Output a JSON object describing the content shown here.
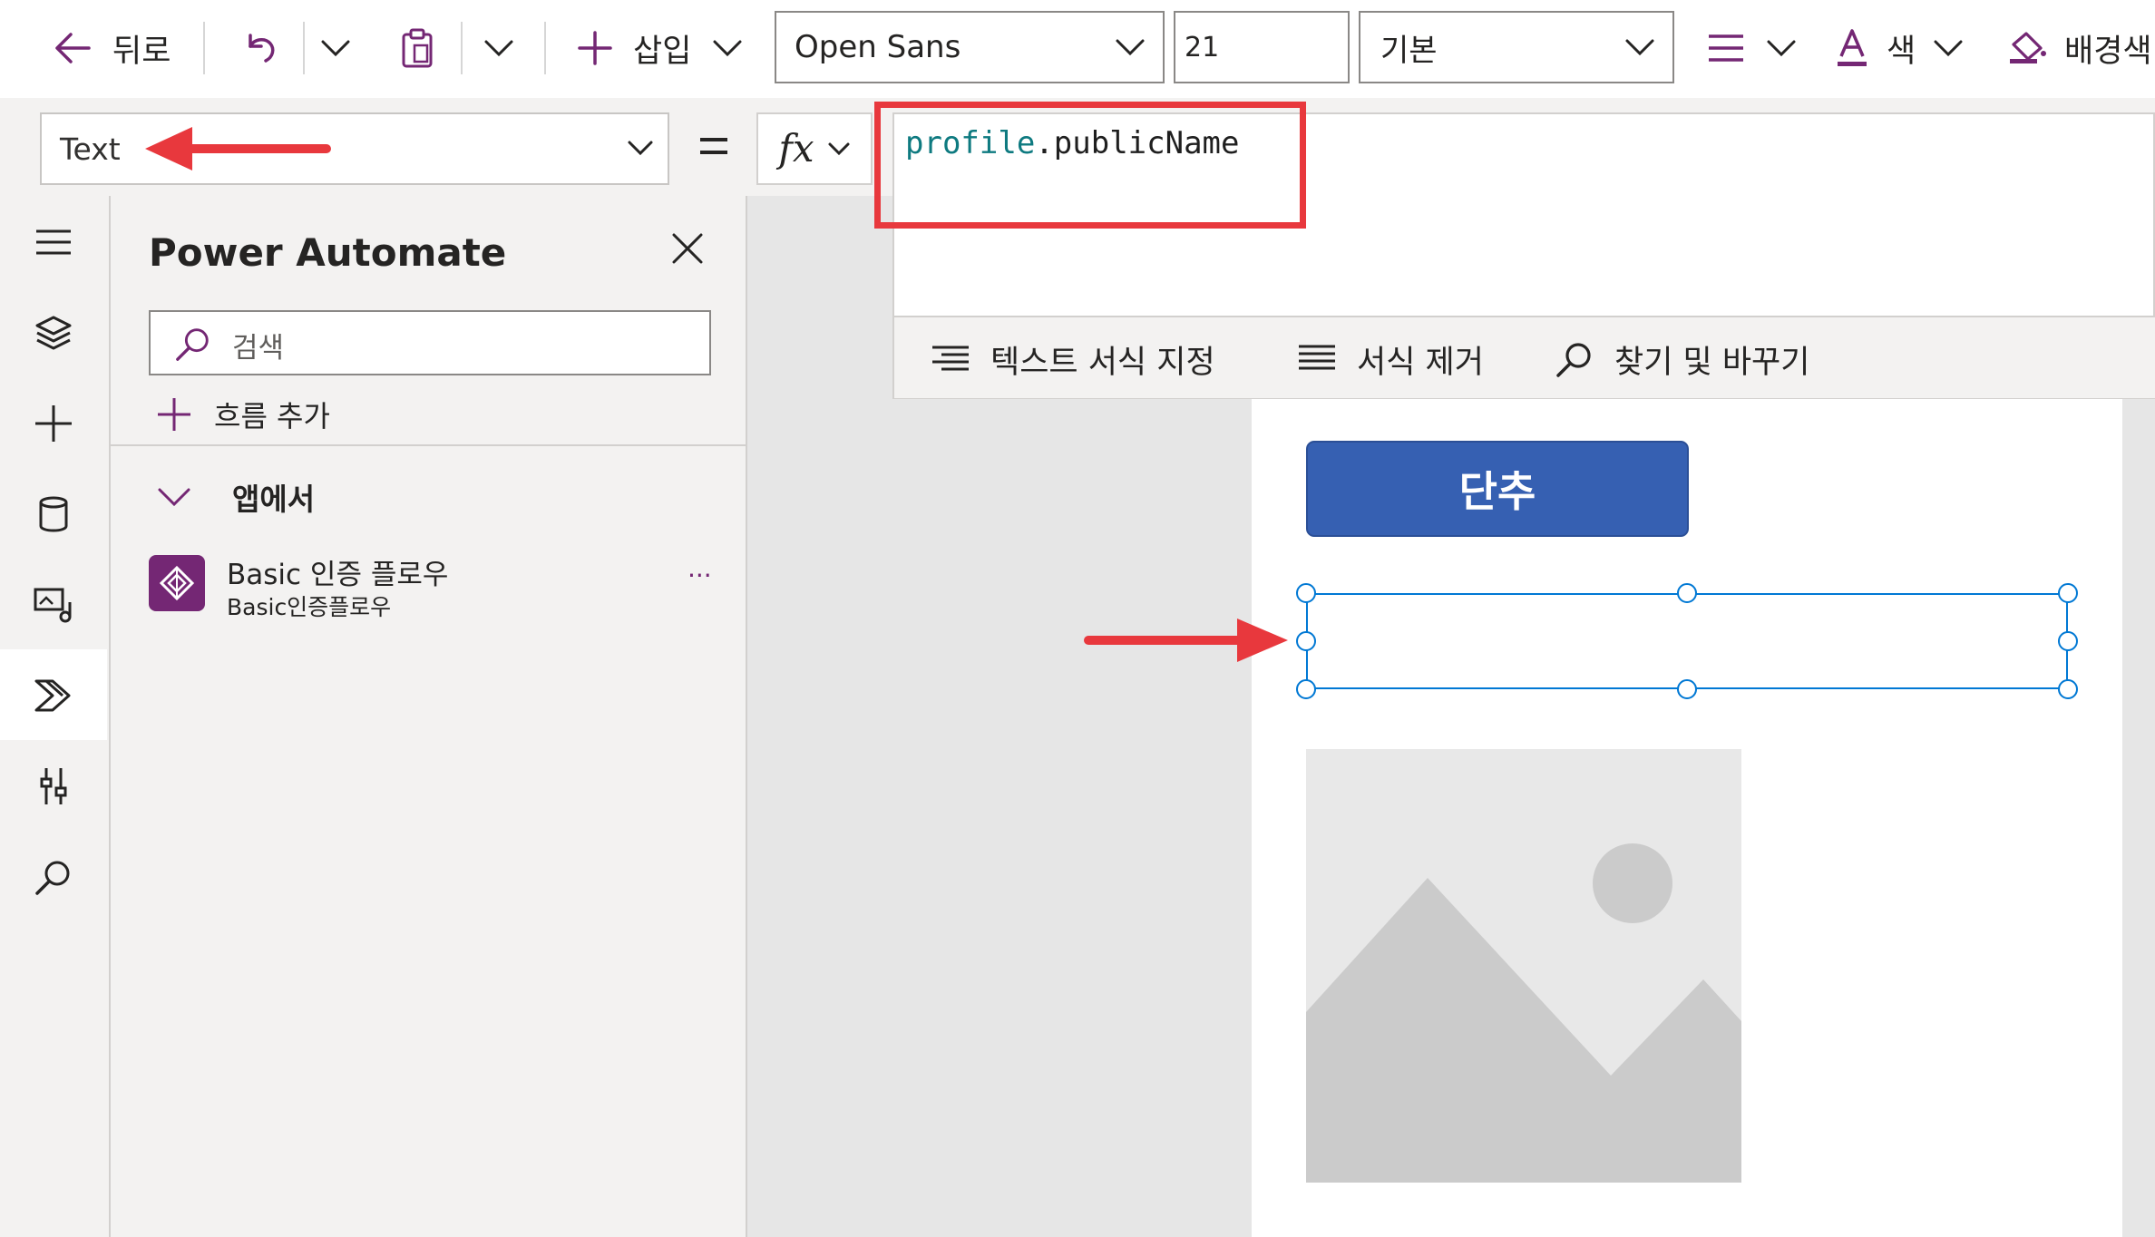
{
  "toolbar": {
    "back_label": "뒤로",
    "insert_label": "삽입",
    "font_name": "Open Sans",
    "font_size": "21",
    "font_weight": "기본",
    "color_label": "색",
    "fill_label": "배경색"
  },
  "formula_bar": {
    "property": "Text",
    "formula_object": "profile",
    "formula_dot": ".",
    "formula_member": "publicName"
  },
  "formula_tools": {
    "format_text": "텍스트 서식 지정",
    "remove_format": "서식 제거",
    "find_replace": "찾기 및 바꾸기"
  },
  "panel": {
    "title": "Power Automate",
    "search_placeholder": "검색",
    "add_flow": "흐름 추가",
    "section_label": "앱에서",
    "flows": [
      {
        "name": "Basic 인증 플로우",
        "subtitle": "Basic인증플로우",
        "more": "..."
      }
    ]
  },
  "canvas": {
    "button_label": "단추"
  },
  "colors": {
    "accent_purple": "#742774",
    "button_blue": "#3660b2",
    "annotation_red": "#e8383d",
    "selection_blue": "#0078d4",
    "formula_teal": "#0e7a80"
  }
}
